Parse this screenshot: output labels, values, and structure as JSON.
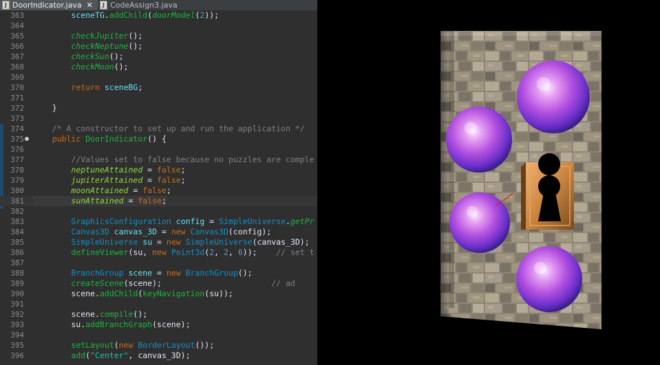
{
  "tabs": [
    {
      "label": "DoorIndicator.java",
      "active": true
    },
    {
      "label": "CodeAssign3.java",
      "active": false
    }
  ],
  "code_lines": [
    {
      "n": "363",
      "tokens": [
        [
          "pl",
          "        "
        ],
        [
          "va",
          "sceneTG"
        ],
        [
          "pl",
          "."
        ],
        [
          "fn",
          "addChild"
        ],
        [
          "pl",
          "("
        ],
        [
          "fi",
          "doorModel"
        ],
        [
          "pl",
          "("
        ],
        [
          "nu",
          "2"
        ],
        [
          "pl",
          "));"
        ]
      ]
    },
    {
      "n": "364",
      "tokens": []
    },
    {
      "n": "365",
      "tokens": [
        [
          "pl",
          "        "
        ],
        [
          "fi",
          "checkJupiter"
        ],
        [
          "pl",
          "();"
        ]
      ]
    },
    {
      "n": "366",
      "tokens": [
        [
          "pl",
          "        "
        ],
        [
          "fi",
          "checkNeptune"
        ],
        [
          "pl",
          "();"
        ]
      ]
    },
    {
      "n": "367",
      "tokens": [
        [
          "pl",
          "        "
        ],
        [
          "fi",
          "checkSun"
        ],
        [
          "pl",
          "();"
        ]
      ]
    },
    {
      "n": "368",
      "tokens": [
        [
          "pl",
          "        "
        ],
        [
          "fi",
          "checkMoon"
        ],
        [
          "pl",
          "();"
        ]
      ]
    },
    {
      "n": "369",
      "tokens": []
    },
    {
      "n": "370",
      "tokens": [
        [
          "pl",
          "        "
        ],
        [
          "kw",
          "return"
        ],
        [
          "pl",
          " "
        ],
        [
          "va",
          "sceneBG"
        ],
        [
          "pl",
          ";"
        ]
      ]
    },
    {
      "n": "371",
      "tokens": []
    },
    {
      "n": "372",
      "tokens": [
        [
          "pl",
          "    }"
        ]
      ]
    },
    {
      "n": "373",
      "tokens": []
    },
    {
      "n": "374",
      "tokens": [
        [
          "pl",
          "    "
        ],
        [
          "cm",
          "/* A constructor to set up and run the application */"
        ]
      ]
    },
    {
      "n": "375",
      "fold": true,
      "tokens": [
        [
          "pl",
          "    "
        ],
        [
          "kw",
          "public"
        ],
        [
          "pl",
          " "
        ],
        [
          "fn",
          "DoorIndicator"
        ],
        [
          "pl",
          "() {"
        ]
      ]
    },
    {
      "n": "376",
      "tokens": []
    },
    {
      "n": "377",
      "tokens": [
        [
          "pl",
          "        "
        ],
        [
          "cm",
          "//Values set to false because no puzzles are comple"
        ]
      ]
    },
    {
      "n": "378",
      "tokens": [
        [
          "pl",
          "        "
        ],
        [
          "vi",
          "neptuneAttained"
        ],
        [
          "pl",
          " = "
        ],
        [
          "kw",
          "false"
        ],
        [
          "pl",
          ";"
        ]
      ]
    },
    {
      "n": "379",
      "tokens": [
        [
          "pl",
          "        "
        ],
        [
          "vi",
          "jupiterAttained"
        ],
        [
          "pl",
          " = "
        ],
        [
          "kw",
          "false"
        ],
        [
          "pl",
          ";"
        ]
      ]
    },
    {
      "n": "380",
      "tokens": [
        [
          "pl",
          "        "
        ],
        [
          "vi",
          "moonAttained"
        ],
        [
          "pl",
          " = "
        ],
        [
          "kw",
          "false"
        ],
        [
          "pl",
          ";"
        ]
      ]
    },
    {
      "n": "381",
      "current": true,
      "tokens": [
        [
          "pl",
          "        "
        ],
        [
          "vi",
          "sunAttained"
        ],
        [
          "pl",
          " = "
        ],
        [
          "kw",
          "false"
        ],
        [
          "pl",
          ";"
        ]
      ]
    },
    {
      "n": "382",
      "tokens": []
    },
    {
      "n": "383",
      "tokens": [
        [
          "pl",
          "        "
        ],
        [
          "ty",
          "GraphicsConfiguration"
        ],
        [
          "pl",
          " "
        ],
        [
          "va",
          "config"
        ],
        [
          "pl",
          " = "
        ],
        [
          "ty",
          "SimpleUniverse"
        ],
        [
          "pl",
          "."
        ],
        [
          "fi",
          "getPr"
        ]
      ]
    },
    {
      "n": "384",
      "tokens": [
        [
          "pl",
          "        "
        ],
        [
          "ty",
          "Canvas3D"
        ],
        [
          "pl",
          " "
        ],
        [
          "va",
          "canvas_3D"
        ],
        [
          "pl",
          " = "
        ],
        [
          "kw",
          "new"
        ],
        [
          "pl",
          " "
        ],
        [
          "ty",
          "Canvas3D"
        ],
        [
          "pl",
          "(config);"
        ]
      ]
    },
    {
      "n": "385",
      "tokens": [
        [
          "pl",
          "        "
        ],
        [
          "ty",
          "SimpleUniverse"
        ],
        [
          "pl",
          " "
        ],
        [
          "va",
          "su"
        ],
        [
          "pl",
          " = "
        ],
        [
          "kw",
          "new"
        ],
        [
          "pl",
          " "
        ],
        [
          "ty",
          "SimpleUniverse"
        ],
        [
          "pl",
          "(canvas_3D);"
        ]
      ]
    },
    {
      "n": "386",
      "tokens": [
        [
          "pl",
          "        "
        ],
        [
          "fn",
          "defineViewer"
        ],
        [
          "pl",
          "(su, "
        ],
        [
          "kw",
          "new"
        ],
        [
          "pl",
          " "
        ],
        [
          "ty",
          "Point3d"
        ],
        [
          "pl",
          "("
        ],
        [
          "nu",
          "2"
        ],
        [
          "pl",
          ", "
        ],
        [
          "nu",
          "2"
        ],
        [
          "pl",
          ", "
        ],
        [
          "nu",
          "6"
        ],
        [
          "pl",
          "));    "
        ],
        [
          "cm",
          "// set t"
        ]
      ]
    },
    {
      "n": "387",
      "tokens": []
    },
    {
      "n": "388",
      "tokens": [
        [
          "pl",
          "        "
        ],
        [
          "ty",
          "BranchGroup"
        ],
        [
          "pl",
          " "
        ],
        [
          "va",
          "scene"
        ],
        [
          "pl",
          " = "
        ],
        [
          "kw",
          "new"
        ],
        [
          "pl",
          " "
        ],
        [
          "ty",
          "BranchGroup"
        ],
        [
          "pl",
          "();"
        ]
      ]
    },
    {
      "n": "389",
      "tokens": [
        [
          "pl",
          "        "
        ],
        [
          "fi",
          "createScene"
        ],
        [
          "pl",
          "(scene);                       "
        ],
        [
          "cm",
          "// ad"
        ]
      ]
    },
    {
      "n": "390",
      "tokens": [
        [
          "pl",
          "        scene."
        ],
        [
          "fn",
          "addChild"
        ],
        [
          "pl",
          "("
        ],
        [
          "fn",
          "keyNavigation"
        ],
        [
          "pl",
          "(su));"
        ]
      ]
    },
    {
      "n": "391",
      "tokens": []
    },
    {
      "n": "392",
      "tokens": [
        [
          "pl",
          "        scene."
        ],
        [
          "fn",
          "compile"
        ],
        [
          "pl",
          "();"
        ]
      ]
    },
    {
      "n": "393",
      "tokens": [
        [
          "pl",
          "        su."
        ],
        [
          "fn",
          "addBranchGraph"
        ],
        [
          "pl",
          "(scene);"
        ]
      ]
    },
    {
      "n": "394",
      "tokens": []
    },
    {
      "n": "395",
      "tokens": [
        [
          "pl",
          "        "
        ],
        [
          "fn",
          "setLayout"
        ],
        [
          "pl",
          "("
        ],
        [
          "kw",
          "new"
        ],
        [
          "pl",
          " "
        ],
        [
          "ty",
          "BorderLayout"
        ],
        [
          "pl",
          "());"
        ]
      ]
    },
    {
      "n": "396",
      "tokens": [
        [
          "pl",
          "        "
        ],
        [
          "fn",
          "add"
        ],
        [
          "pl",
          "("
        ],
        [
          "st",
          "\"Center\""
        ],
        [
          "pl",
          ", canvas_3D);"
        ]
      ]
    }
  ],
  "scene": {
    "background": "#000000",
    "wall_texture": "stone-brick",
    "keyhole_material": "copper",
    "orb_material": "purple-galaxy",
    "orb_count": 4
  },
  "colors": {
    "editor_bg": "#2f2f2f",
    "keyword": "#cc6c1d",
    "type": "#1290c3",
    "method": "#1eb540",
    "field": "#8dda3a",
    "comment": "#808080",
    "string": "#17c6a3"
  }
}
